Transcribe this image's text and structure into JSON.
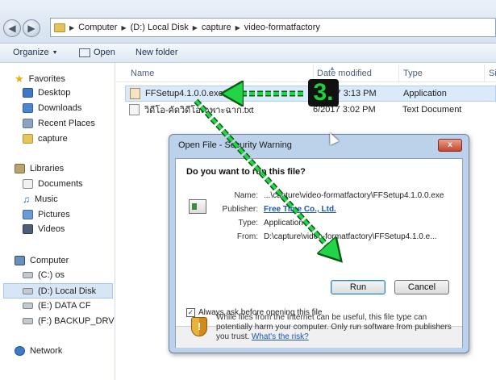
{
  "address_bar": {
    "crumbs": [
      "Computer",
      "(D:) Local Disk",
      "capture",
      "video-formatfactory"
    ]
  },
  "toolbar": {
    "organize": "Organize",
    "open": "Open",
    "new_folder": "New folder"
  },
  "nav": {
    "favorites": "Favorites",
    "desktop": "Desktop",
    "downloads": "Downloads",
    "recent_places": "Recent Places",
    "capture": "capture",
    "libraries": "Libraries",
    "documents": "Documents",
    "music": "Music",
    "pictures": "Pictures",
    "videos": "Videos",
    "computer": "Computer",
    "drive_c": "(C:) os",
    "drive_d": "(D:) Local Disk",
    "drive_e": "(E:) DATA CF",
    "drive_f": "(F:) BACKUP_DRV",
    "network": "Network"
  },
  "columns": {
    "name": "Name",
    "date_modified": "Date modified",
    "type": "Type",
    "size": "Si"
  },
  "files": [
    {
      "name": "FFSetup4.1.0.0.exe",
      "date": "6/2017 3:13 PM",
      "type": "Application"
    },
    {
      "name": "วิดีโอ-คัดวิดีโอเฉพาะฉาก.txt",
      "date": "6/2017 3:02 PM",
      "type": "Text Document"
    }
  ],
  "dialog": {
    "title": "Open File - Security Warning",
    "close": "x",
    "heading": "Do you want to run this file?",
    "labels": {
      "name": "Name:",
      "publisher": "Publisher:",
      "type": "Type:",
      "from": "From:"
    },
    "values": {
      "name": "...\\capture\\video-formatfactory\\FFSetup4.1.0.0.exe",
      "publisher": "Free Time Co., Ltd.",
      "type": "Application",
      "from": "D:\\capture\\video-formatfactory\\FFSetup4.1.0.e..."
    },
    "run": "Run",
    "cancel": "Cancel",
    "always_ask": "Always ask before opening this file",
    "always_ask_checked": true,
    "footer_text": "While files from the Internet can be useful, this file type can potentially harm your computer. Only run software from publishers you trust.",
    "footer_link": "What's the risk?"
  },
  "annotation": {
    "step": "3.",
    "arrow_color": "#22d447"
  }
}
